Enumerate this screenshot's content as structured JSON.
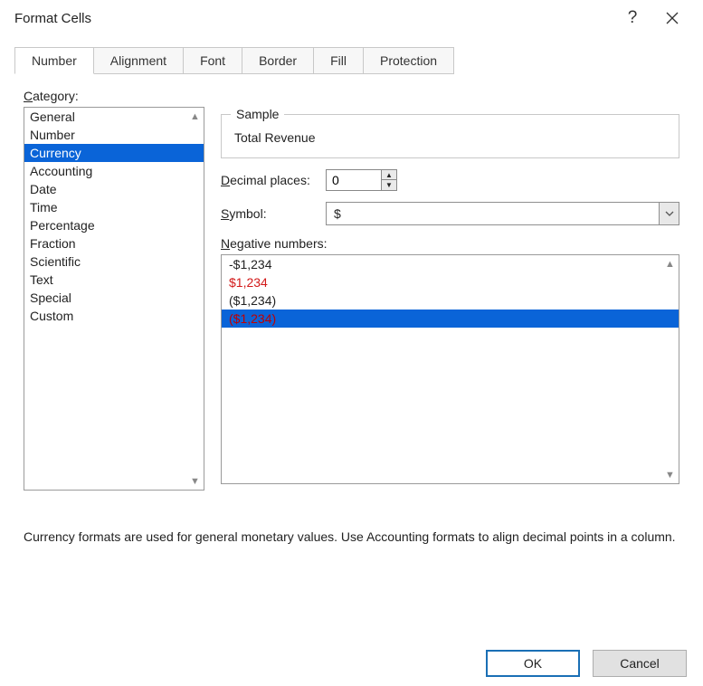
{
  "window": {
    "title": "Format Cells"
  },
  "tabs": [
    "Number",
    "Alignment",
    "Font",
    "Border",
    "Fill",
    "Protection"
  ],
  "category": {
    "label_pre": "C",
    "label_rest": "ategory:",
    "items": [
      "General",
      "Number",
      "Currency",
      "Accounting",
      "Date",
      "Time",
      "Percentage",
      "Fraction",
      "Scientific",
      "Text",
      "Special",
      "Custom"
    ],
    "selected_index": 2
  },
  "sample": {
    "legend": "Sample",
    "value": "Total Revenue"
  },
  "decimal": {
    "label_pre": "D",
    "label_rest": "ecimal places:",
    "value": "0"
  },
  "symbol": {
    "label_pre": "S",
    "label_rest": "ymbol:",
    "value": "$"
  },
  "negative": {
    "label_pre": "N",
    "label_rest": "egative numbers:",
    "items": [
      {
        "text": "-$1,234",
        "color": "normal"
      },
      {
        "text": "$1,234",
        "color": "red"
      },
      {
        "text": "($1,234)",
        "color": "normal"
      },
      {
        "text": "($1,234)",
        "color": "red"
      }
    ],
    "selected_index": 3
  },
  "description": "Currency formats are used for general monetary values.  Use Accounting formats to align decimal points in a column.",
  "buttons": {
    "ok": "OK",
    "cancel": "Cancel"
  }
}
